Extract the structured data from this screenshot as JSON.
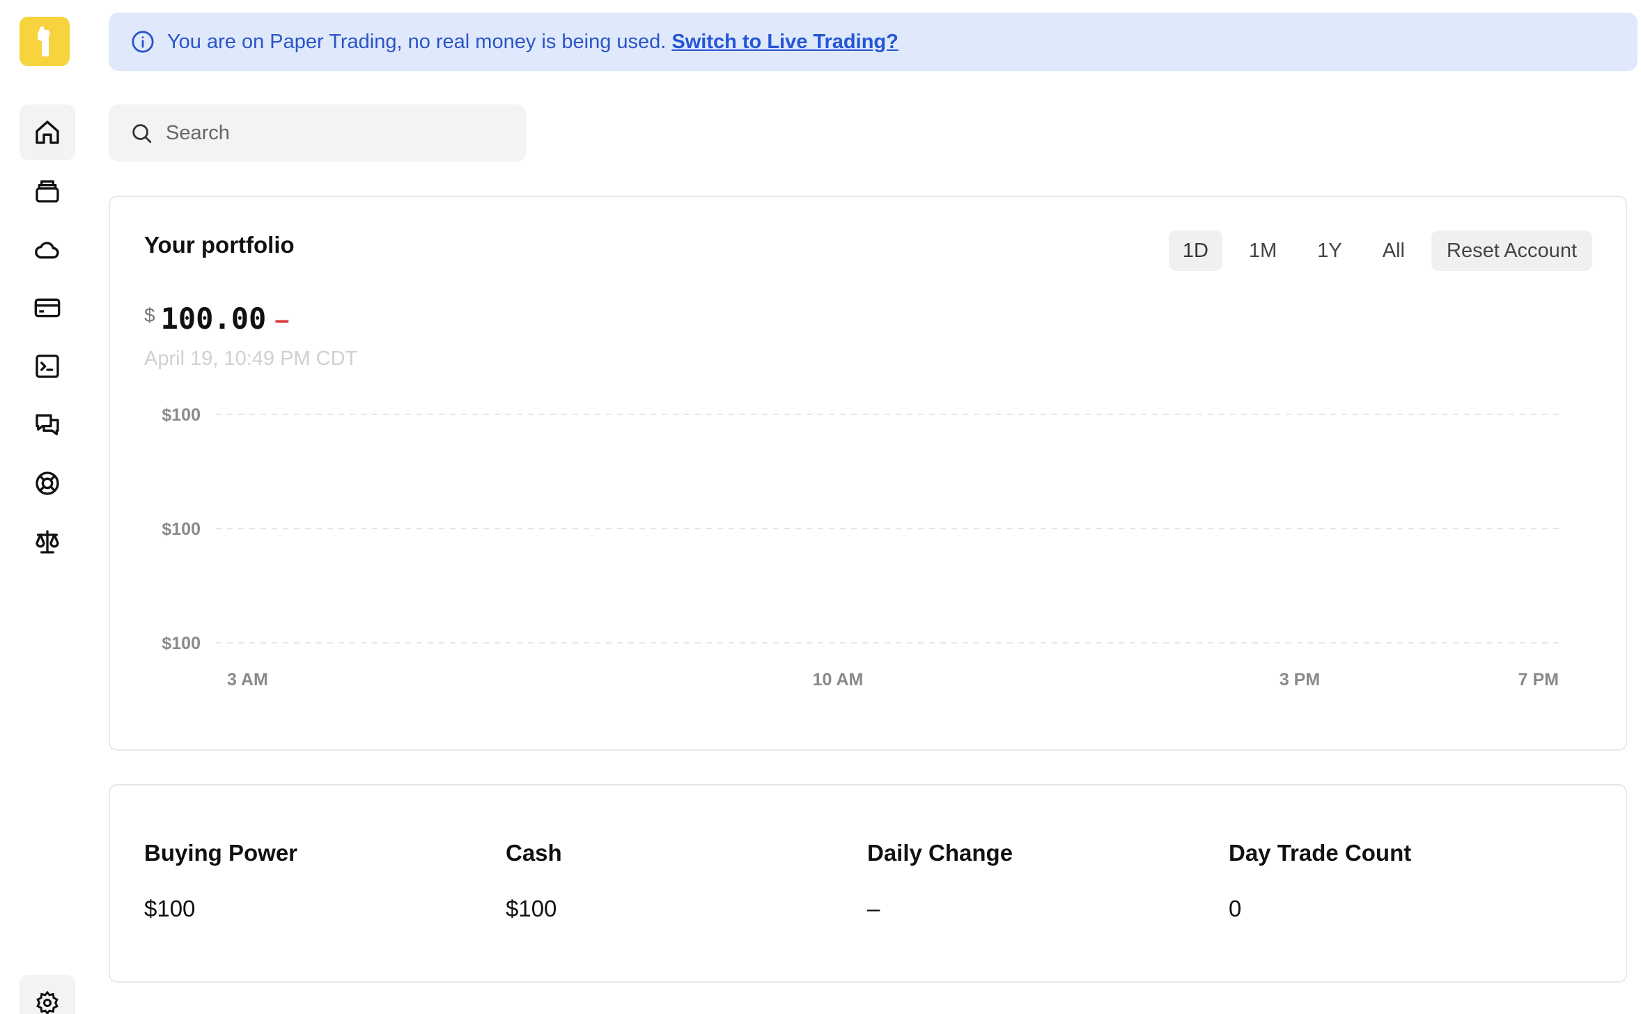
{
  "banner": {
    "message": "You are on Paper Trading, no real money is being used.",
    "link_text": "Switch to Live Trading?",
    "icon": "info-icon"
  },
  "search": {
    "placeholder": "Search"
  },
  "sidebar": {
    "items": [
      {
        "icon": "home-icon",
        "active": true
      },
      {
        "icon": "stack-icon"
      },
      {
        "icon": "cloud-icon"
      },
      {
        "icon": "credit-card-icon"
      },
      {
        "icon": "terminal-icon"
      },
      {
        "icon": "chat-icon"
      },
      {
        "icon": "support-icon"
      },
      {
        "icon": "scale-icon"
      }
    ],
    "settings_icon": "gear-icon"
  },
  "portfolio": {
    "title": "Your portfolio",
    "currency": "$",
    "value": "100.00",
    "change": "–",
    "timestamp": "April 19, 10:49 PM CDT",
    "ranges": [
      "1D",
      "1M",
      "1Y",
      "All"
    ],
    "active_range": "1D",
    "reset_label": "Reset Account"
  },
  "chart_data": {
    "type": "line",
    "x_ticks": [
      "3 AM",
      "10 AM",
      "3 PM",
      "7 PM"
    ],
    "y_ticks": [
      "$100",
      "$100",
      "$100"
    ],
    "series": [],
    "grid": true
  },
  "stats": [
    {
      "label": "Buying Power",
      "value": "$100"
    },
    {
      "label": "Cash",
      "value": "$100"
    },
    {
      "label": "Daily Change",
      "value": "–"
    },
    {
      "label": "Day Trade Count",
      "value": "0"
    }
  ],
  "colors": {
    "accent": "#2456d6",
    "banner_bg": "#dfe9fb",
    "logo": "#f7d33d",
    "negative": "#d93a3a"
  }
}
